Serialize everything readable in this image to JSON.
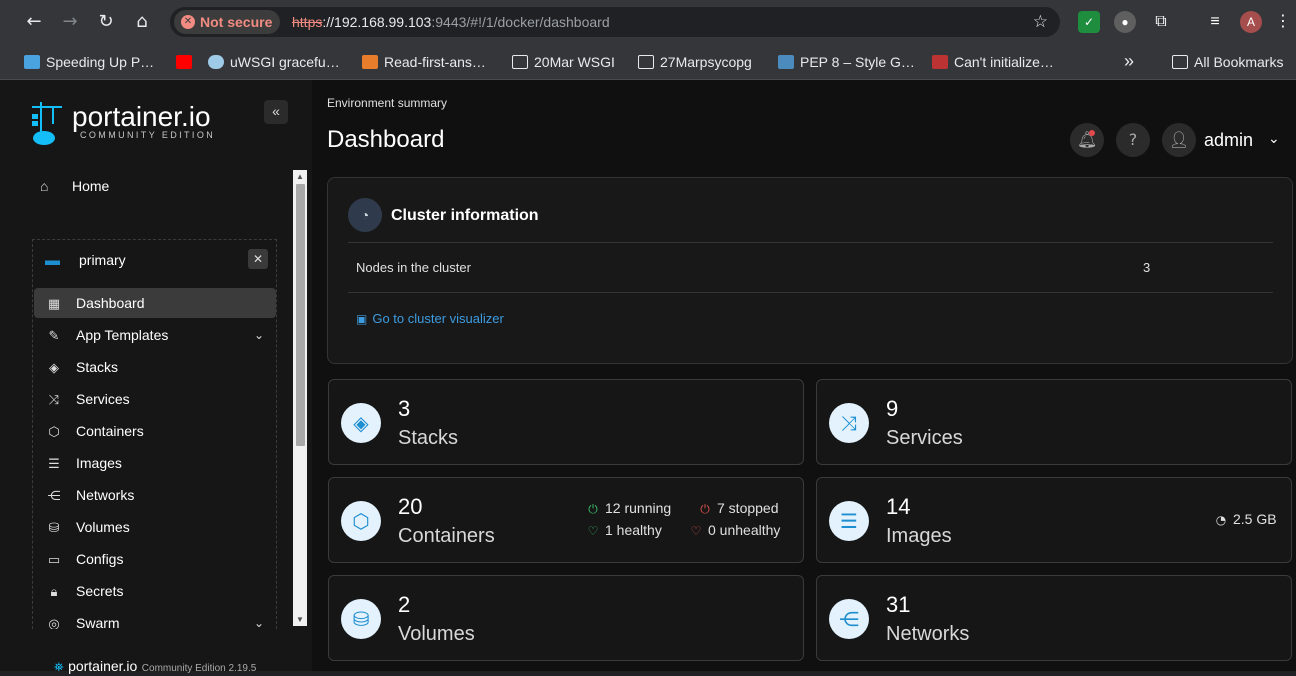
{
  "browser": {
    "not_secure": "Not secure",
    "url_scheme": "https",
    "url_host": "://192.168.99.103",
    "url_rest": ":9443/#!/1/docker/dashboard",
    "profile_initial": "A"
  },
  "bookmarks": [
    {
      "label": "Speeding Up P…"
    },
    {
      "label": "uWSGI gracefu…"
    },
    {
      "label": "Read-first-ans…"
    },
    {
      "label": "20Mar WSGI"
    },
    {
      "label": "27Marpsycopg"
    },
    {
      "label": "PEP 8 – Style G…"
    },
    {
      "label": "Can't initialize…"
    }
  ],
  "bookmarks_more": "»",
  "all_bookmarks": "All Bookmarks",
  "sidebar": {
    "logo_text": "portainer.io",
    "logo_sub": "COMMUNITY EDITION",
    "home": "Home",
    "env_name": "primary",
    "menu": [
      {
        "label": "Dashboard"
      },
      {
        "label": "App Templates"
      },
      {
        "label": "Stacks"
      },
      {
        "label": "Services"
      },
      {
        "label": "Containers"
      },
      {
        "label": "Images"
      },
      {
        "label": "Networks"
      },
      {
        "label": "Volumes"
      },
      {
        "label": "Configs"
      },
      {
        "label": "Secrets"
      },
      {
        "label": "Swarm"
      }
    ],
    "footer_name": "portainer.io",
    "footer_version": "Community Edition 2.19.5"
  },
  "header": {
    "breadcrumb": "Environment summary",
    "title": "Dashboard",
    "user": "admin"
  },
  "cluster": {
    "title": "Cluster information",
    "nodes_label": "Nodes in the cluster",
    "nodes_value": "3",
    "link": "Go to cluster visualizer"
  },
  "cards": {
    "stacks": {
      "value": "3",
      "label": "Stacks"
    },
    "services": {
      "value": "9",
      "label": "Services"
    },
    "containers": {
      "value": "20",
      "label": "Containers",
      "running": "12 running",
      "stopped": "7 stopped",
      "healthy": "1 healthy",
      "unhealthy": "0 unhealthy"
    },
    "images": {
      "value": "14",
      "label": "Images",
      "size": "2.5 GB"
    },
    "volumes": {
      "value": "2",
      "label": "Volumes"
    },
    "networks": {
      "value": "31",
      "label": "Networks"
    }
  },
  "colors": {
    "accent": "#1d8ecf",
    "link": "#3d9ce0",
    "running": "#3bbd6a",
    "stopped": "#d9534f"
  }
}
